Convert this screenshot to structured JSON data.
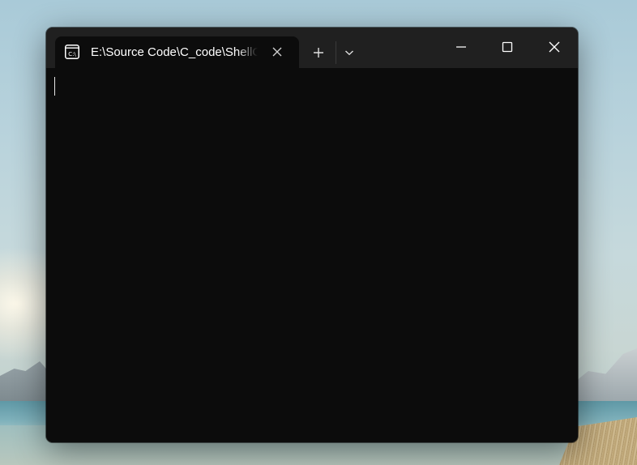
{
  "window": {
    "tab": {
      "title": "E:\\Source Code\\C_code\\ShellCode",
      "icon": "command-prompt-icon",
      "icon_text": "C:\\"
    },
    "buttons": {
      "new_tab": "plus-icon",
      "dropdown": "chevron-down-icon",
      "minimize": "minimize-icon",
      "maximize": "maximize-icon",
      "close": "close-icon"
    }
  },
  "colors": {
    "titlebar": "#202020",
    "terminal_bg": "#0c0c0c",
    "text": "#ffffff"
  }
}
